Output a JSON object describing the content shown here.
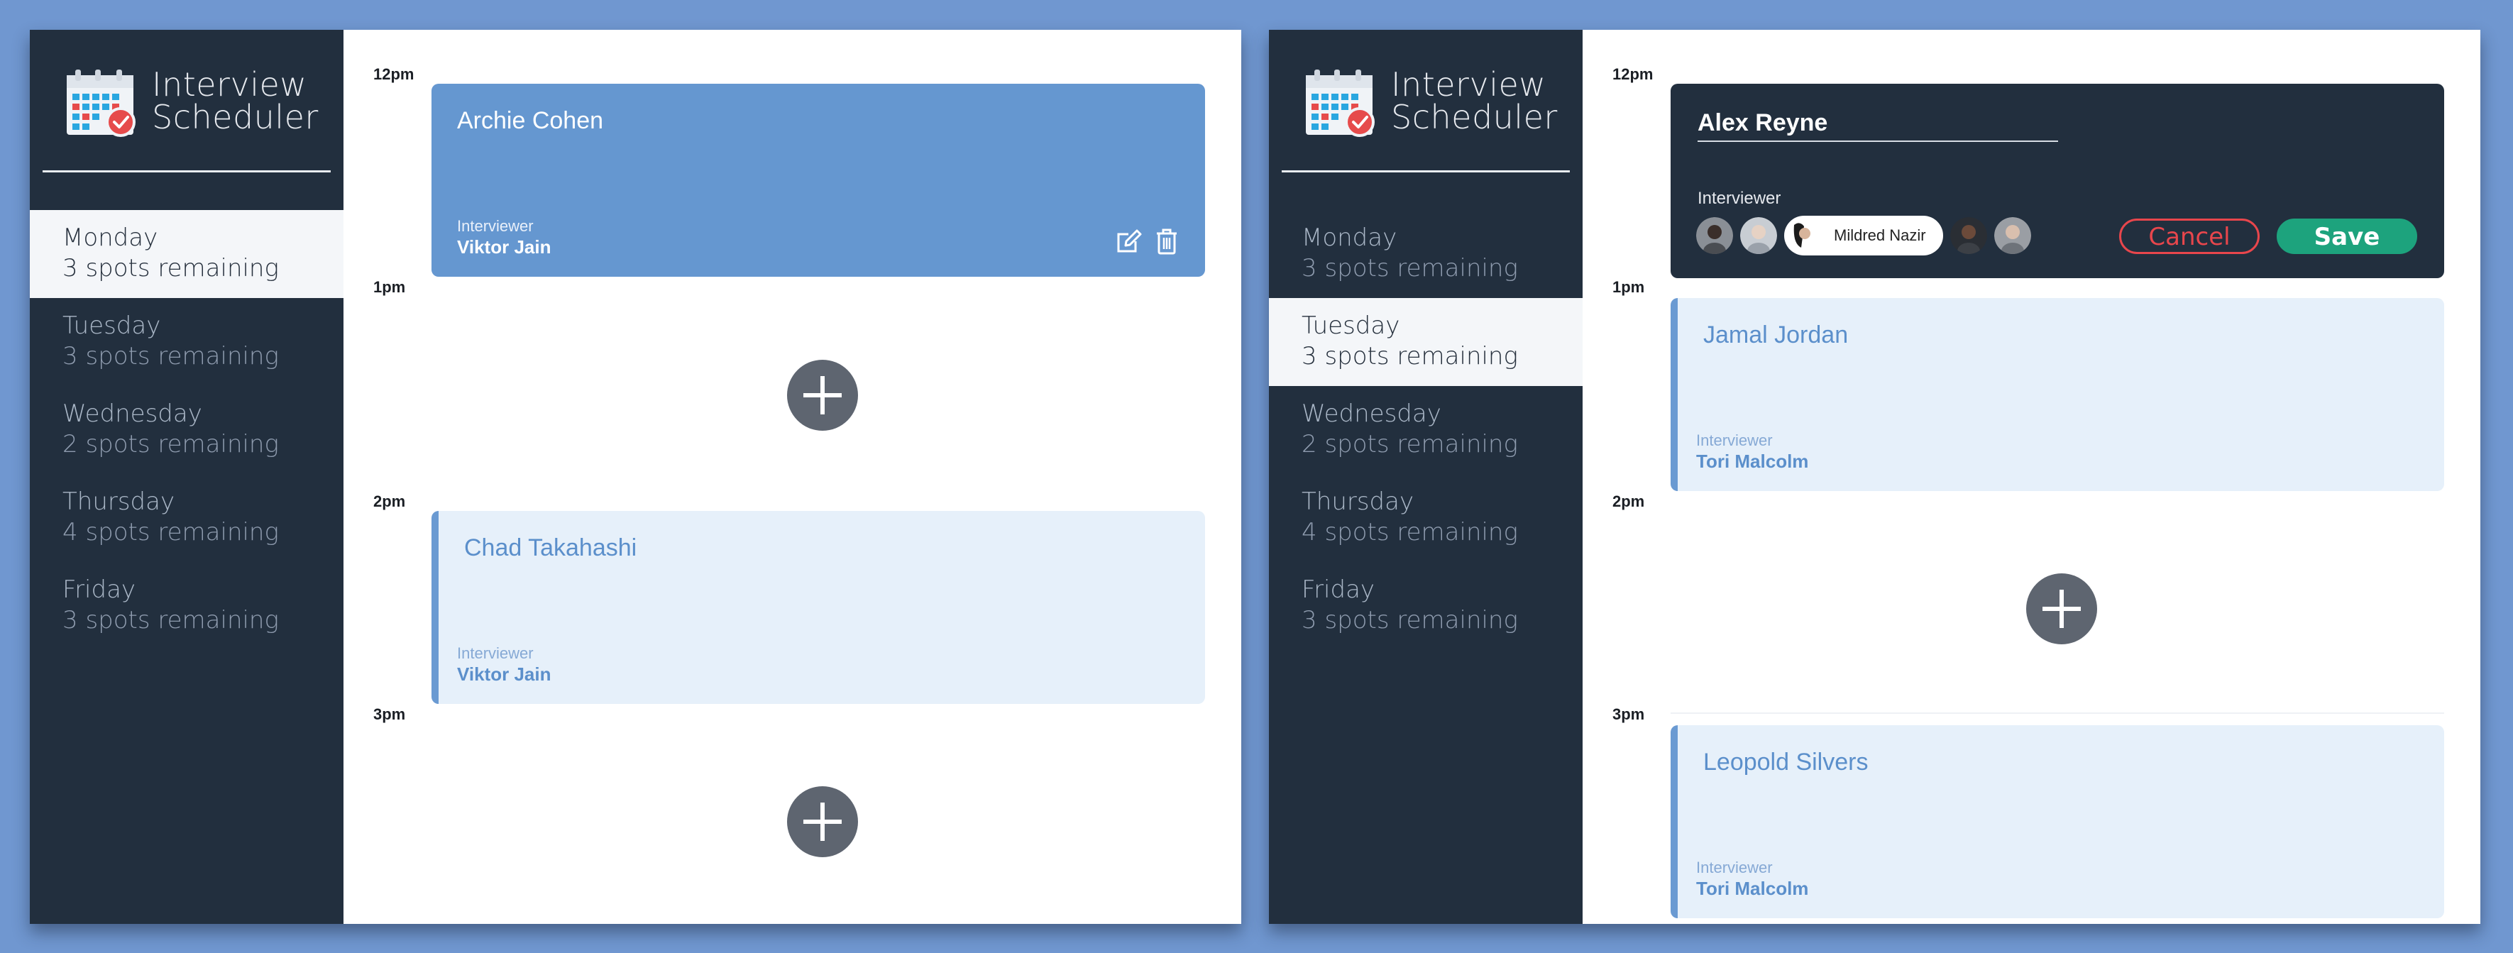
{
  "app": {
    "title_line1": "Interview",
    "title_line2": "Scheduler"
  },
  "colors": {
    "page_background": "#7097d0",
    "sidebar": "#222f3e",
    "appointment_filled": "#6597d0",
    "appointment_light": "#e6f0fa",
    "cancel": "#e8464c",
    "save": "#1da37d",
    "add_button": "#5e6570"
  },
  "icons": {
    "logo": "calendar-check-icon",
    "edit": "edit-icon",
    "delete": "trash-icon",
    "add": "plus-icon"
  },
  "panels": [
    {
      "selected_day": "Monday",
      "days": [
        {
          "name": "Monday",
          "spots": "3 spots remaining"
        },
        {
          "name": "Tuesday",
          "spots": "3 spots remaining"
        },
        {
          "name": "Wednesday",
          "spots": "2 spots remaining"
        },
        {
          "name": "Thursday",
          "spots": "4 spots remaining"
        },
        {
          "name": "Friday",
          "spots": "3 spots remaining"
        }
      ],
      "times": [
        "12pm",
        "1pm",
        "2pm",
        "3pm"
      ],
      "appointments": [
        {
          "student": "Archie Cohen",
          "interviewer_label": "Interviewer",
          "interviewer": "Viktor Jain",
          "style": "filled"
        },
        {
          "student": "Chad Takahashi",
          "interviewer_label": "Interviewer",
          "interviewer": "Viktor Jain",
          "style": "light"
        }
      ]
    },
    {
      "selected_day": "Tuesday",
      "days": [
        {
          "name": "Monday",
          "spots": "3 spots remaining"
        },
        {
          "name": "Tuesday",
          "spots": "3 spots remaining"
        },
        {
          "name": "Wednesday",
          "spots": "2 spots remaining"
        },
        {
          "name": "Thursday",
          "spots": "4 spots remaining"
        },
        {
          "name": "Friday",
          "spots": "3 spots remaining"
        }
      ],
      "times": [
        "12pm",
        "1pm",
        "2pm",
        "3pm"
      ],
      "editor": {
        "student_value": "Alex Reyne",
        "interviewer_label": "Interviewer",
        "selected_interviewer": "Mildred Nazir",
        "cancel_label": "Cancel",
        "save_label": "Save"
      },
      "appointments": [
        {
          "student": "Jamal Jordan",
          "interviewer_label": "Interviewer",
          "interviewer": "Tori Malcolm",
          "style": "light"
        },
        {
          "student": "Leopold Silvers",
          "interviewer_label": "Interviewer",
          "interviewer": "Tori Malcolm",
          "style": "light"
        }
      ]
    }
  ]
}
